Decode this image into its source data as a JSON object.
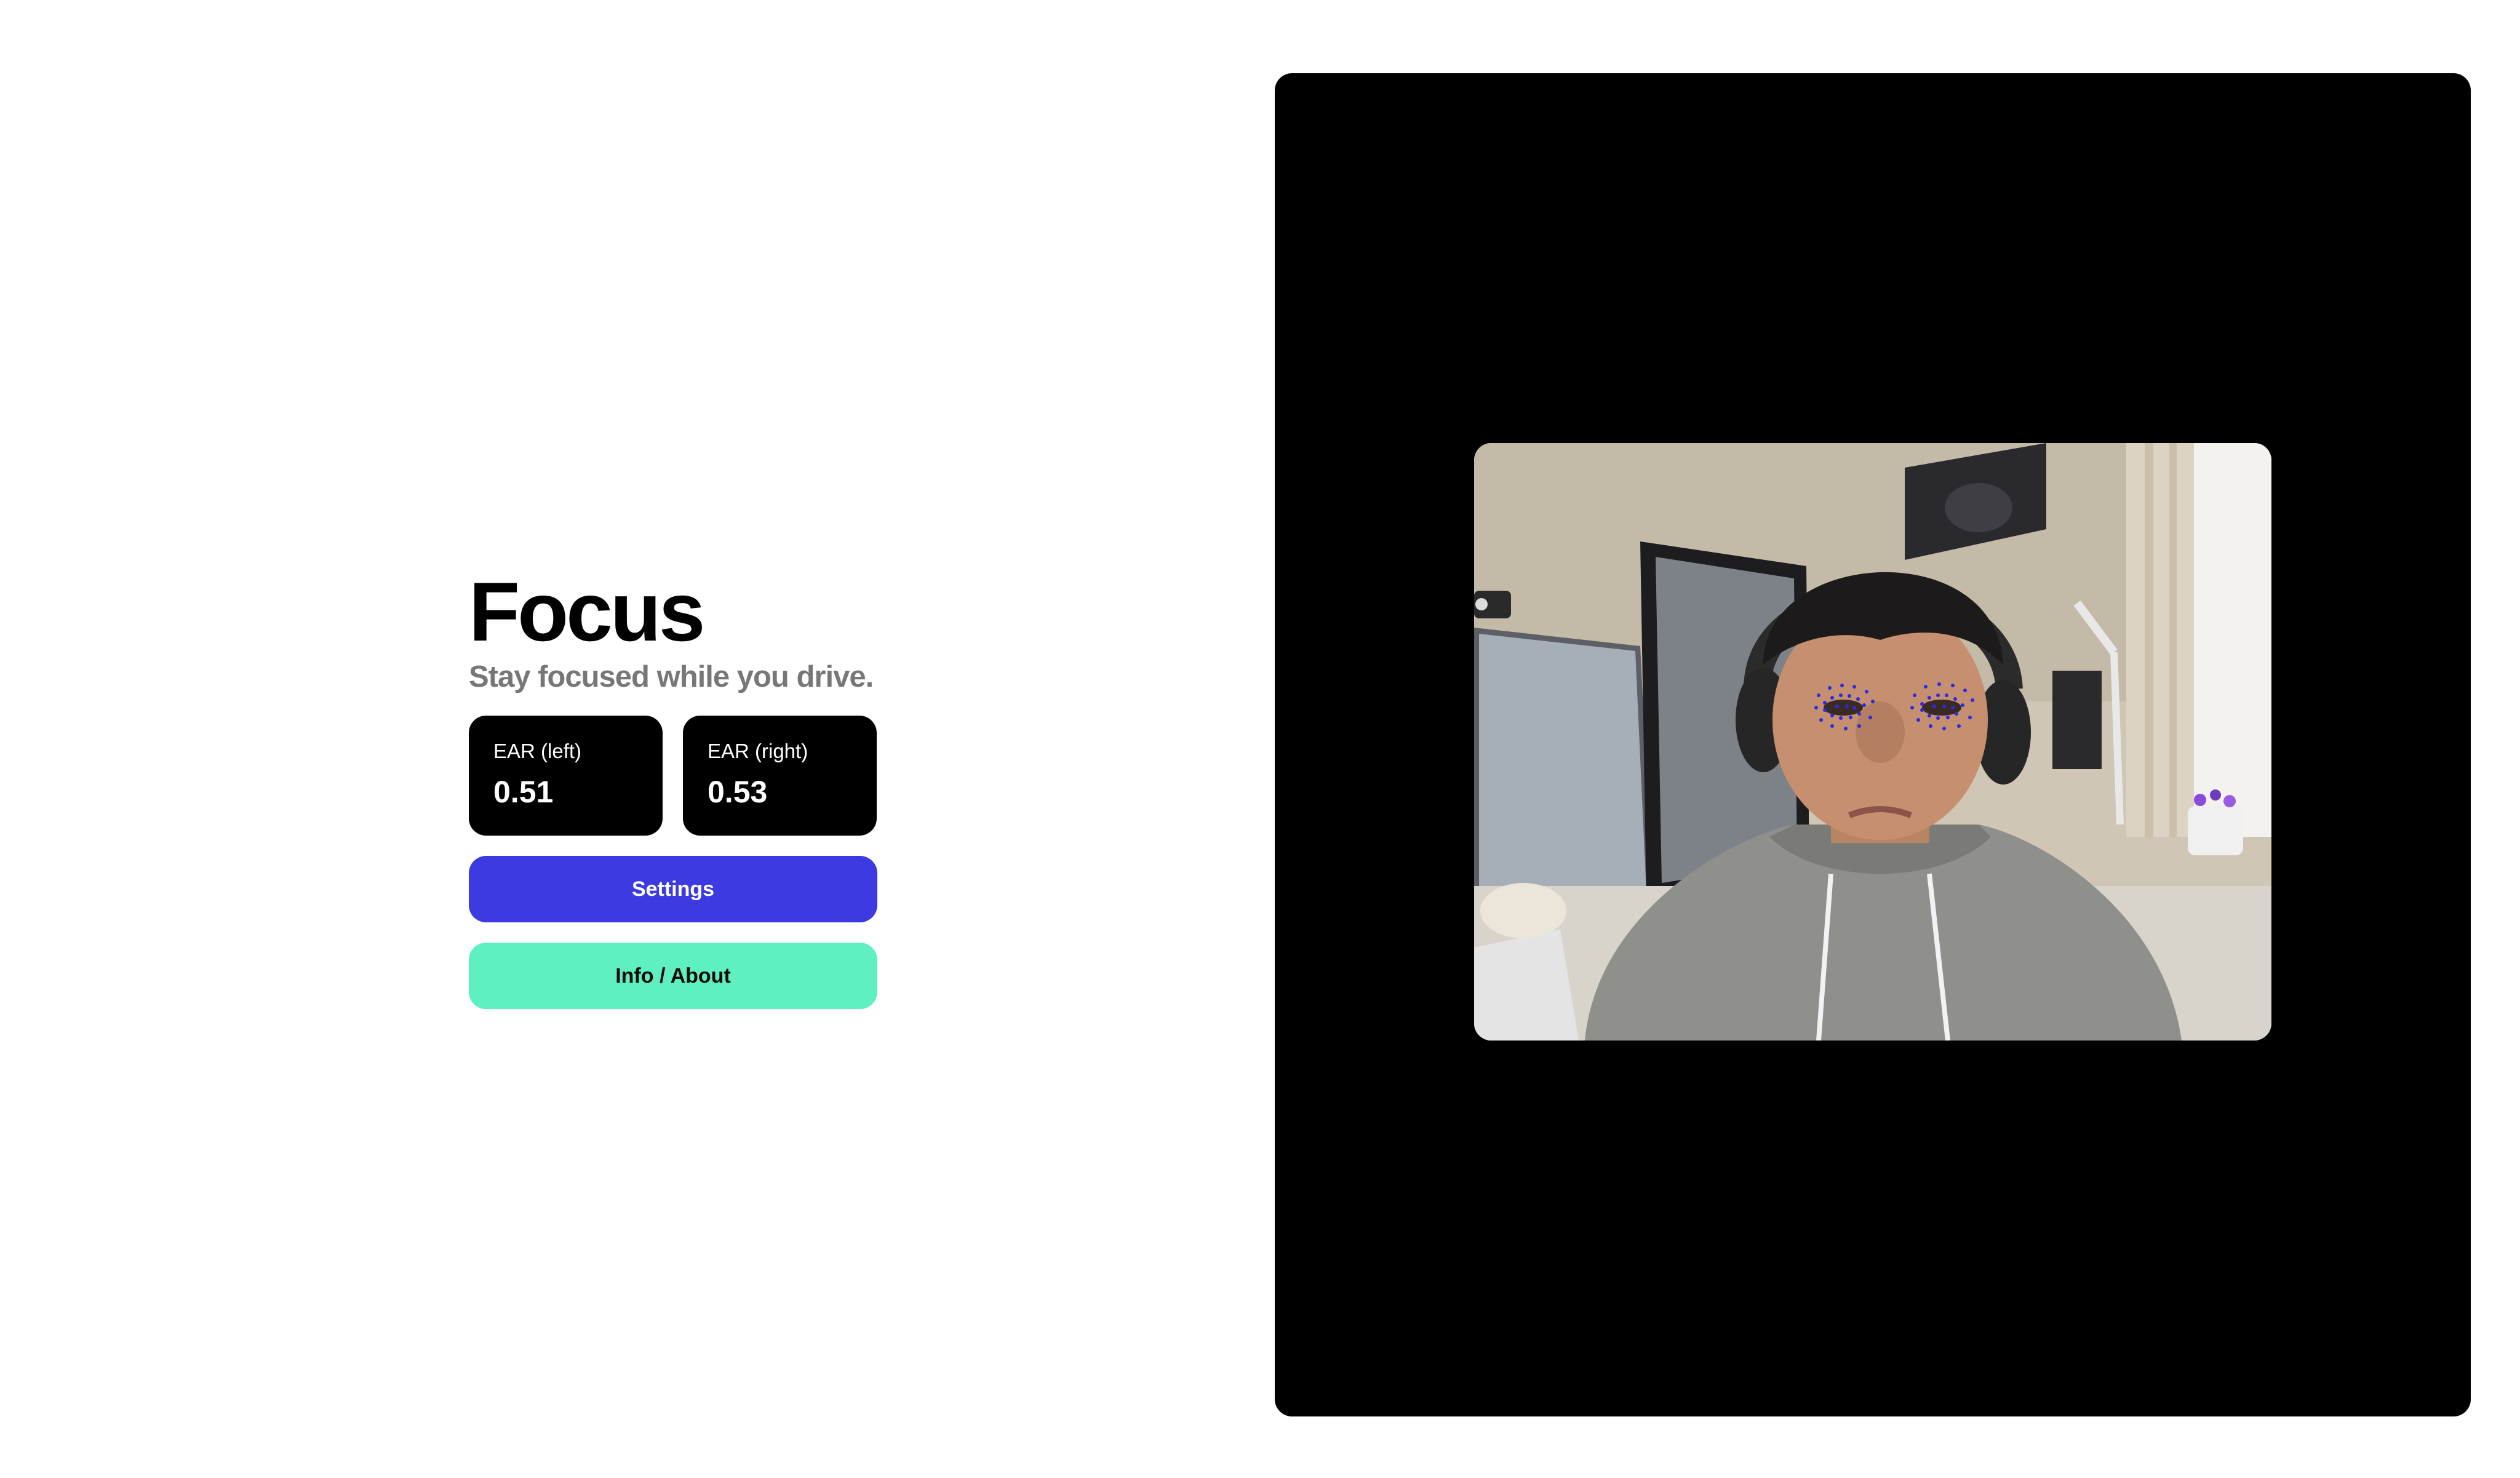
{
  "app": {
    "title": "Focus",
    "subtitle": "Stay focused while you drive."
  },
  "stats": {
    "left": {
      "label": "EAR (left)",
      "value": "0.51"
    },
    "right": {
      "label": "EAR (right)",
      "value": "0.53"
    }
  },
  "buttons": {
    "settings_label": "Settings",
    "info_label": "Info / About"
  },
  "colors": {
    "settings_button": "#3c3ae0",
    "info_button": "#5ef0c0",
    "stat_card": "#000000",
    "camera_background": "#000000",
    "eye_landmarks": "#2a2ae8"
  },
  "camera": {
    "eye_landmarks_visible": true
  }
}
